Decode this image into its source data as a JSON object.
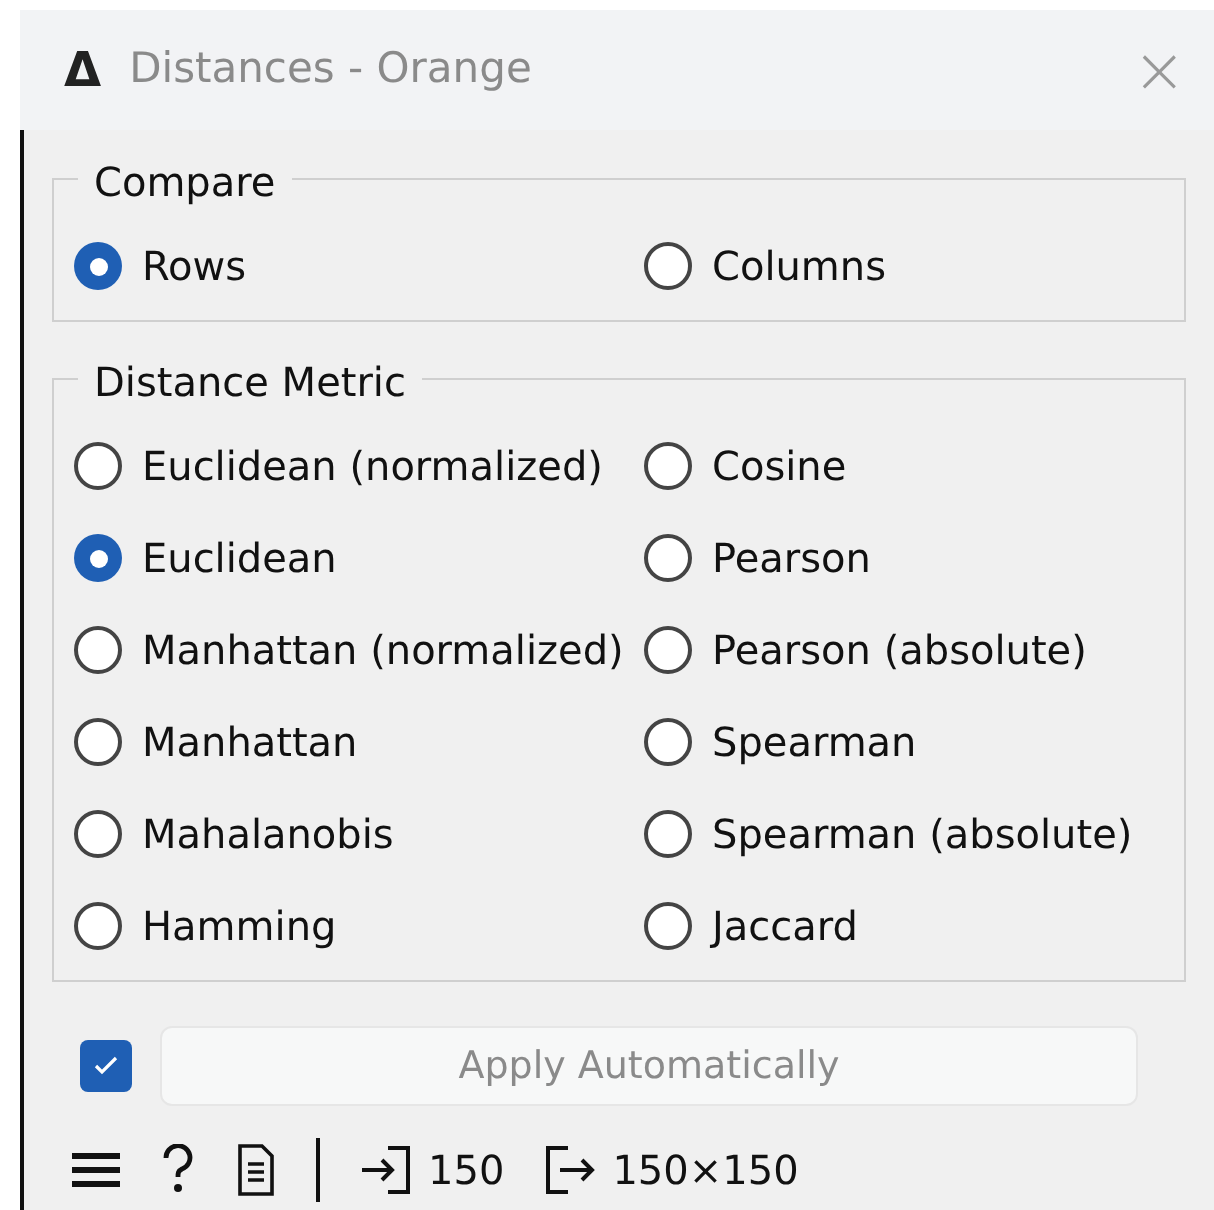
{
  "window": {
    "title": "Distances - Orange",
    "icon": "Δ",
    "close": "×"
  },
  "compare": {
    "title": "Compare",
    "options": [
      {
        "label": "Rows",
        "selected": true
      },
      {
        "label": "Columns",
        "selected": false
      }
    ]
  },
  "distance_metric": {
    "title": "Distance Metric",
    "options": [
      {
        "label": "Euclidean (normalized)",
        "selected": false
      },
      {
        "label": "Cosine",
        "selected": false
      },
      {
        "label": "Euclidean",
        "selected": true
      },
      {
        "label": "Pearson",
        "selected": false
      },
      {
        "label": "Manhattan (normalized)",
        "selected": false
      },
      {
        "label": "Pearson (absolute)",
        "selected": false
      },
      {
        "label": "Manhattan",
        "selected": false
      },
      {
        "label": "Spearman",
        "selected": false
      },
      {
        "label": "Mahalanobis",
        "selected": false
      },
      {
        "label": "Spearman (absolute)",
        "selected": false
      },
      {
        "label": "Hamming",
        "selected": false
      },
      {
        "label": "Jaccard",
        "selected": false
      }
    ]
  },
  "apply": {
    "label": "Apply Automatically",
    "checked": true
  },
  "status_bar": {
    "input": "150",
    "output": "150×150"
  }
}
